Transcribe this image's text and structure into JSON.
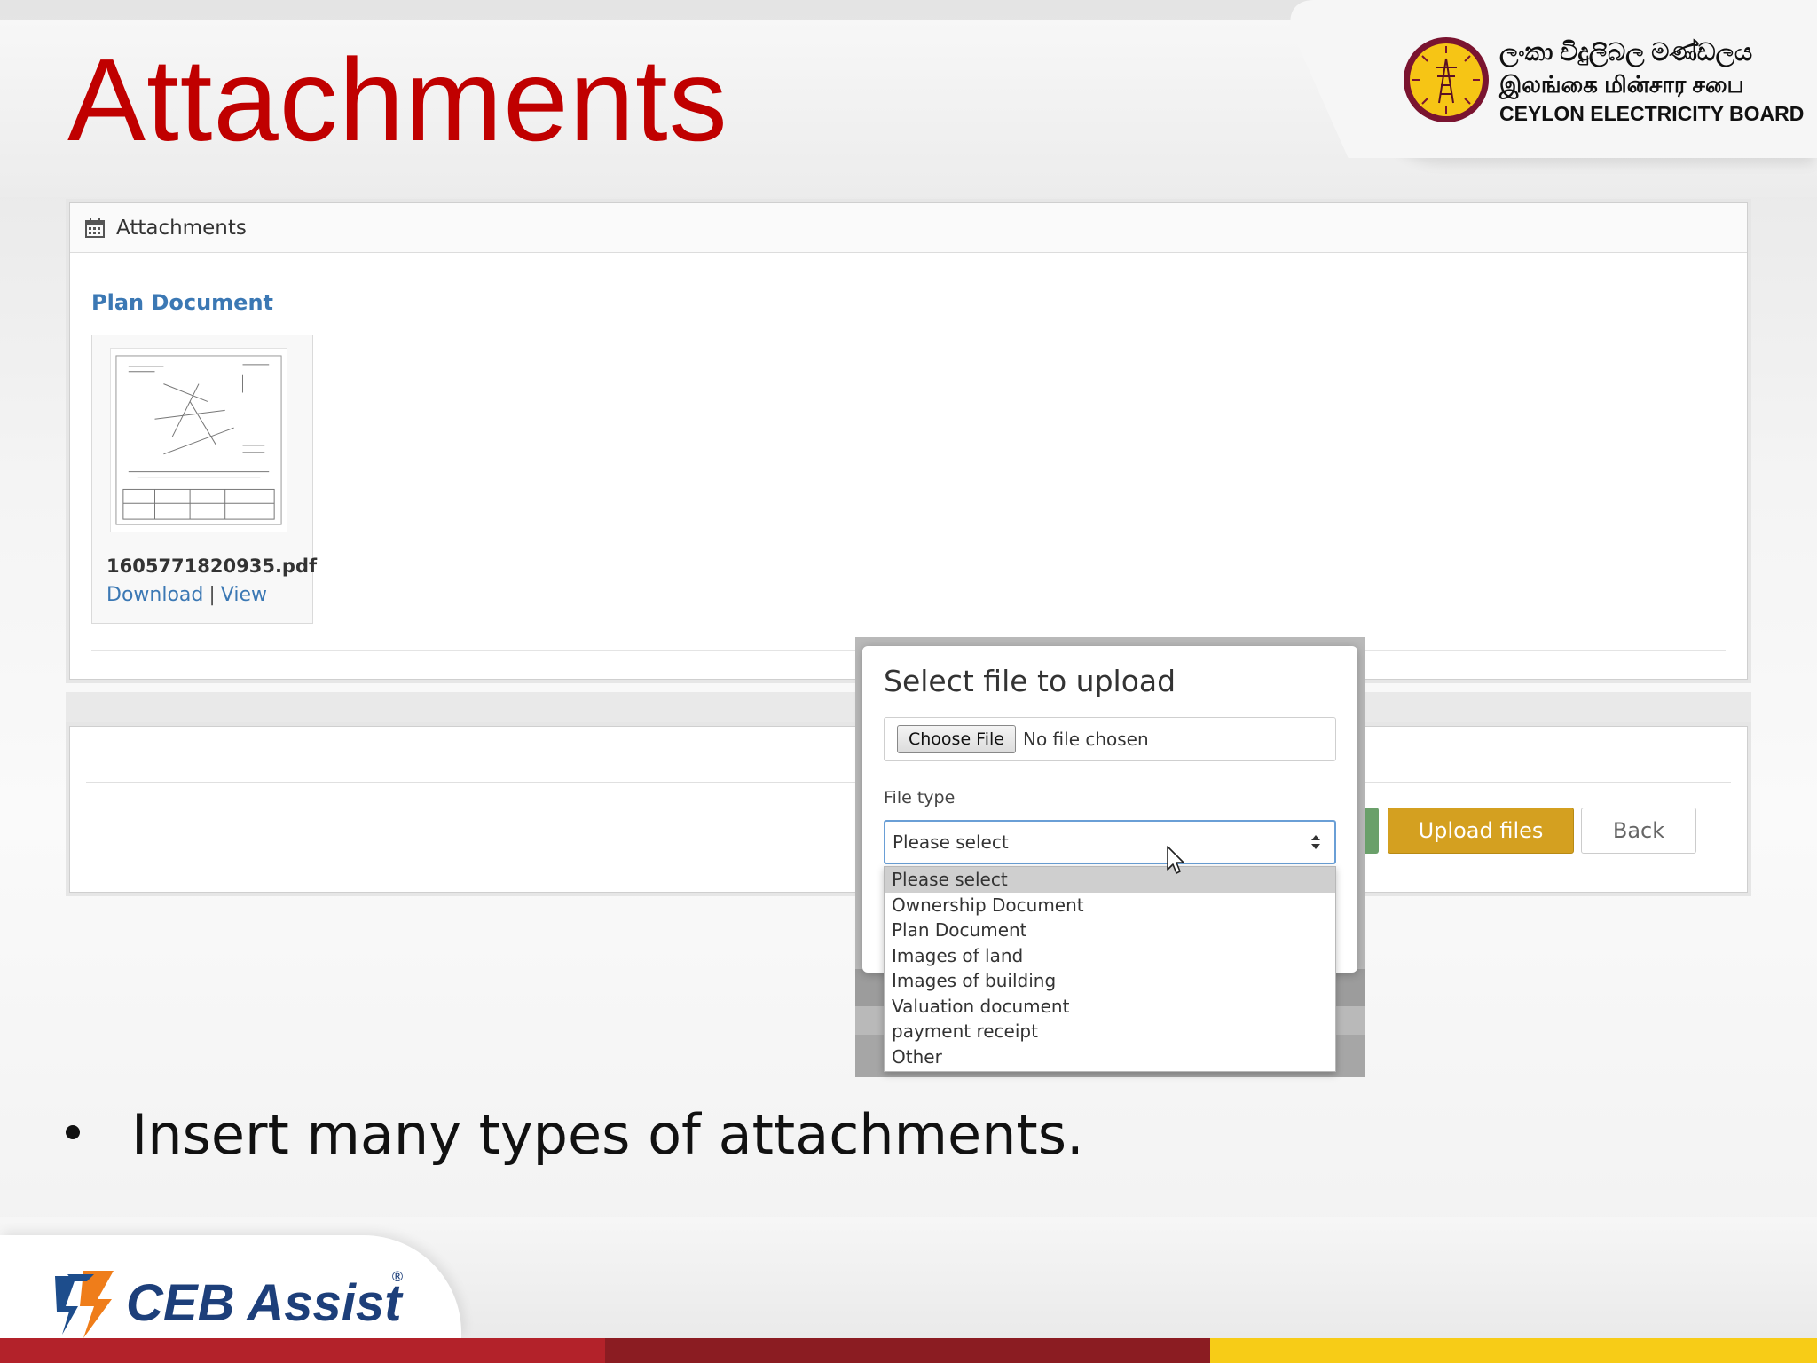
{
  "slide": {
    "title": "Attachments",
    "bullet": "Insert many types of attachments."
  },
  "org": {
    "name_sinhala": "ලංකා විදුලිබල මණ්ඩලය",
    "name_tamil": "இலங்கை மின்சார சபை",
    "name_english": "CEYLON ELECTRICITY BOARD"
  },
  "panel": {
    "header_label": "Attachments",
    "section_title": "Plan Document",
    "file_name": "1605771820935.pdf",
    "download_label": "Download",
    "separator": "|",
    "view_label": "View"
  },
  "actions": {
    "upload_label": "Upload files",
    "back_label": "Back"
  },
  "modal": {
    "title": "Select file to upload",
    "choose_file_label": "Choose File",
    "no_file_text": "No file chosen",
    "file_type_label": "File type",
    "selected_value": "Please select",
    "options": [
      "Please select",
      "Ownership Document",
      "Plan Document",
      "Images of land",
      "Images of building",
      "Valuation document",
      "payment receipt",
      "Other"
    ]
  },
  "brand": {
    "product_name": "CEB Assist",
    "registered_mark": "®",
    "title_color": "#c00000",
    "link_color": "#3b78b4",
    "upload_color": "#d4a020",
    "stripe_colors": [
      "#b3222a",
      "#8b1c22",
      "#f7cc17"
    ]
  }
}
